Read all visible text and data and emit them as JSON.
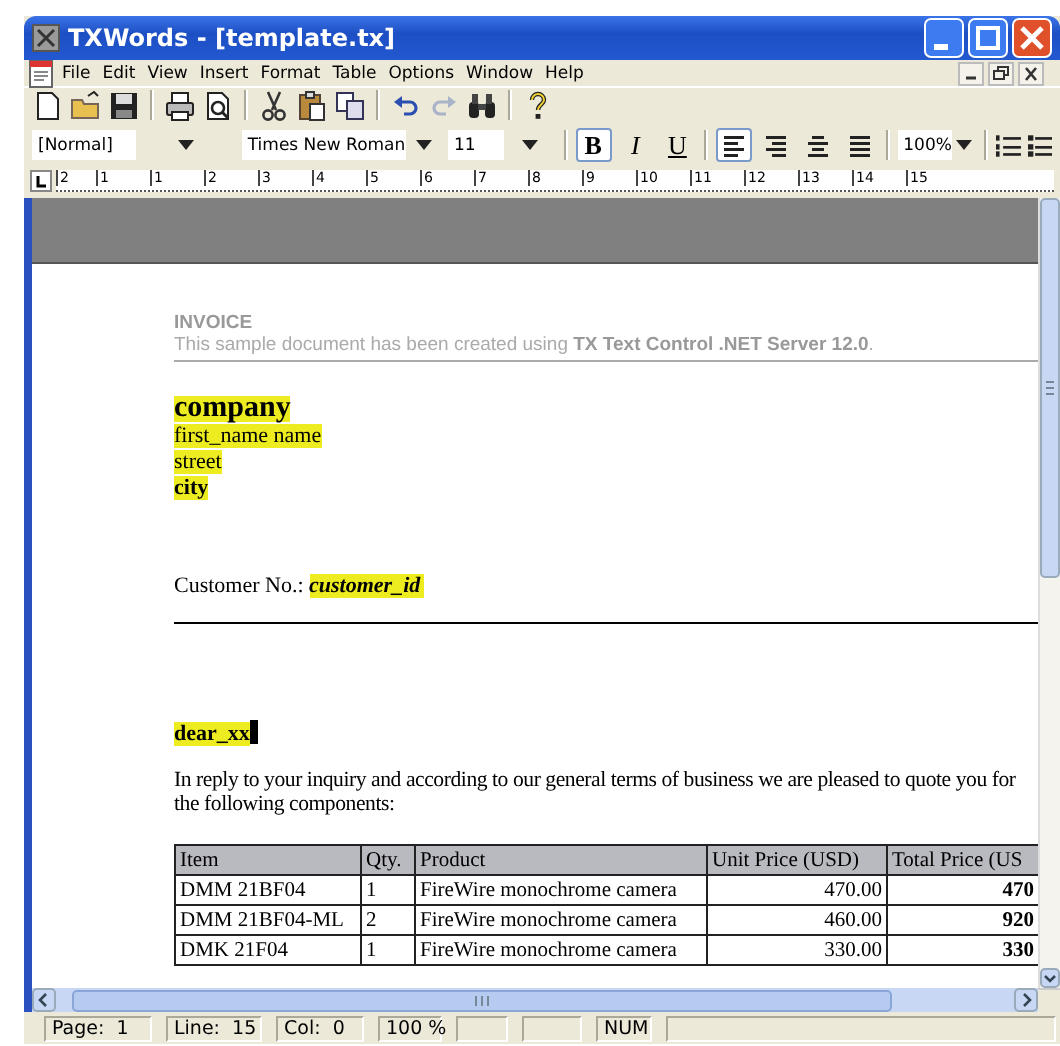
{
  "window": {
    "title": "TXWords - [template.tx]"
  },
  "menu": [
    {
      "label": "File"
    },
    {
      "label": "Edit"
    },
    {
      "label": "View"
    },
    {
      "label": "Insert"
    },
    {
      "label": "Format"
    },
    {
      "label": "Table"
    },
    {
      "label": "Options"
    },
    {
      "label": "Window"
    },
    {
      "label": "Help"
    }
  ],
  "toolbar": [
    {
      "kind": "new",
      "disabled": false
    },
    {
      "kind": "open",
      "disabled": false
    },
    {
      "kind": "save",
      "disabled": false
    },
    {
      "kind": "sep"
    },
    {
      "kind": "print",
      "disabled": false
    },
    {
      "kind": "preview",
      "disabled": false
    },
    {
      "kind": "sep"
    },
    {
      "kind": "cut",
      "disabled": false
    },
    {
      "kind": "paste",
      "disabled": false
    },
    {
      "kind": "copy",
      "disabled": false
    },
    {
      "kind": "sep"
    },
    {
      "kind": "undo",
      "disabled": false
    },
    {
      "kind": "redo",
      "disabled": true
    },
    {
      "kind": "find",
      "disabled": false
    },
    {
      "kind": "sep"
    },
    {
      "kind": "help",
      "disabled": false
    }
  ],
  "format_bar": {
    "style": "[Normal]",
    "font": "Times New Roman",
    "size": "11",
    "zoom": "100%",
    "text_buttons": [
      {
        "kind": "bold",
        "label": "B",
        "selected": true
      },
      {
        "kind": "italic",
        "label": "I",
        "selected": false
      },
      {
        "kind": "underline",
        "label": "U",
        "selected": false
      }
    ],
    "align_buttons": [
      {
        "kind": "left",
        "selected": true
      },
      {
        "kind": "right",
        "selected": false
      },
      {
        "kind": "center",
        "selected": false
      },
      {
        "kind": "justify",
        "selected": false
      }
    ]
  },
  "ruler": {
    "labels": [
      "2",
      "1",
      "1",
      "2",
      "3",
      "4",
      "5",
      "6",
      "7",
      "8",
      "9",
      "10",
      "11",
      "12",
      "13",
      "14",
      "15"
    ]
  },
  "document": {
    "heading": "INVOICE",
    "subtitle": "This sample document has been created using **TX Text Control .NET Server 12.0**.",
    "fields": [
      {
        "text": "company",
        "kind": "title"
      },
      {
        "text": "first_name name",
        "kind": "plain"
      },
      {
        "text": "street",
        "kind": "plain"
      },
      {
        "text": "city",
        "kind": "bold"
      }
    ],
    "customer_label": "Customer No.:",
    "customer_field": "customer_id",
    "salutation": "dear_xx",
    "paragraph": "In reply to your inquiry and according to our general terms of business we are pleased to quote you for the following components:",
    "table": {
      "columns": [
        "Item",
        "Qty.",
        "Product",
        "Unit Price (USD)",
        "Total Price (US"
      ],
      "rows": [
        [
          "DMM 21BF04",
          "1",
          "FireWire monochrome camera",
          "470.00",
          "470"
        ],
        [
          "DMM 21BF04-ML",
          "2",
          "FireWire monochrome camera",
          "460.00",
          "920"
        ],
        [
          "DMK 21F04",
          "1",
          "FireWire monochrome camera",
          "330.00",
          "330"
        ]
      ]
    }
  },
  "status_bar": {
    "panels": [
      {
        "text": "Page:  1"
      },
      {
        "text": "Line:  15"
      },
      {
        "text": "Col:  0"
      },
      {
        "text": "100 %"
      },
      {
        "text": "NUM"
      }
    ]
  }
}
